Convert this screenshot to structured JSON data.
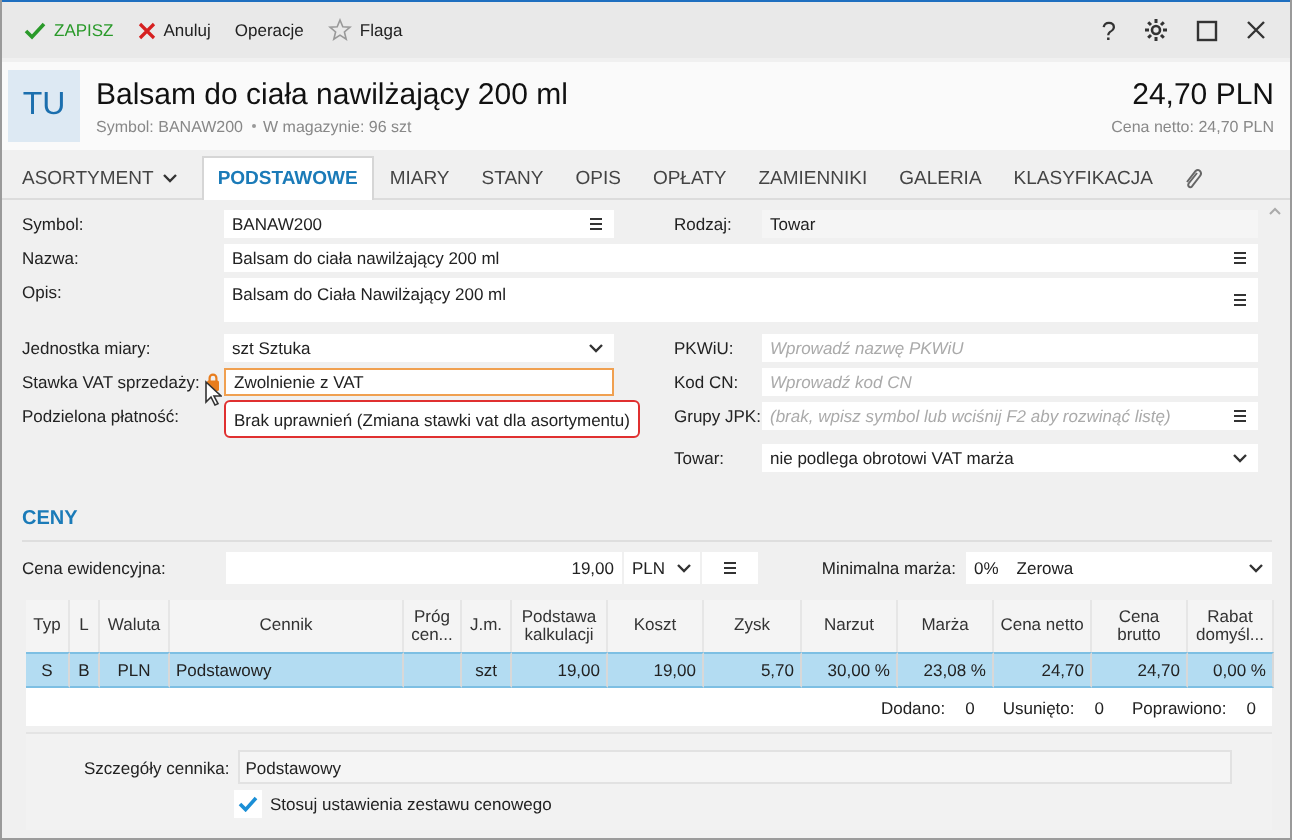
{
  "toolbar": {
    "actions": [
      {
        "kind": "save",
        "label": "ZAPISZ"
      },
      {
        "kind": "cancel",
        "label": "Anuluj"
      },
      {
        "kind": "menu",
        "label": "Operacje"
      },
      {
        "kind": "flag",
        "label": "Flaga"
      }
    ],
    "help": "?"
  },
  "header": {
    "avatar": "TU",
    "title": "Balsam do ciała nawilżający 200 ml",
    "symbol": "Symbol: BANAW200",
    "stock": "W magazynie: 96 szt",
    "price": "24,70 PLN",
    "net_price": "Cena netto: 24,70 PLN"
  },
  "tabs": [
    {
      "label": "ASORTYMENT",
      "kind": "dropdown",
      "selected": false
    },
    {
      "label": "PODSTAWOWE",
      "kind": "tab",
      "selected": true
    },
    {
      "label": "MIARY",
      "kind": "tab",
      "selected": false
    },
    {
      "label": "STANY",
      "kind": "tab",
      "selected": false
    },
    {
      "label": "OPIS",
      "kind": "tab",
      "selected": false
    },
    {
      "label": "OPŁATY",
      "kind": "tab",
      "selected": false
    },
    {
      "label": "ZAMIENNIKI",
      "kind": "tab",
      "selected": false
    },
    {
      "label": "GALERIA",
      "kind": "tab",
      "selected": false
    },
    {
      "label": "KLASYFIKACJA",
      "kind": "tab",
      "selected": false
    },
    {
      "kind": "attachment",
      "selected": false
    }
  ],
  "form": {
    "rows": [
      [
        {
          "label": "Symbol:",
          "value": "BANAW200",
          "kind": "list"
        },
        {
          "label": "Rodzaj:",
          "value": "Towar",
          "kind": "readonly"
        }
      ],
      [
        {
          "label": "Nazwa:",
          "value": "Balsam do ciała nawilżający 200 ml",
          "kind": "list"
        }
      ],
      [
        {
          "label": "Opis:",
          "value": "Balsam do Ciała Nawilżający 200 ml",
          "kind": "memo"
        }
      ]
    ],
    "left": [
      {
        "label": "Jednostka miary:",
        "value": "szt  Sztuka",
        "kind": "select"
      },
      {
        "label": "Stawka VAT sprzedaży:",
        "value": "Zwolnienie z VAT",
        "kind": "locked"
      },
      {
        "label": "Podzielona płatność:",
        "kind": "label"
      }
    ],
    "right": [
      {
        "label": "PKWiU:",
        "placeholder": "Wprowadź nazwę PKWiU",
        "kind": "text"
      },
      {
        "label": "Kod CN:",
        "placeholder": "Wprowadź kod CN",
        "kind": "text"
      },
      {
        "label": "Grupy JPK:",
        "placeholder": "(brak, wpisz symbol lub wciśnij F2 aby rozwinąć listę)",
        "kind": "list"
      },
      {
        "label": "Towar:",
        "value": "nie podlega obrotowi VAT marża",
        "kind": "select"
      }
    ],
    "tooltip": "Brak uprawnień (Zmiana stawki vat dla asortymentu)"
  },
  "prices": {
    "title": "CENY",
    "record_price": {
      "label": "Cena ewidencyjna:",
      "value": "19,00",
      "currency": "PLN"
    },
    "min_margin": {
      "label": "Minimalna marża:",
      "percent": "0%",
      "name": "Zerowa"
    },
    "table": {
      "columns": [
        {
          "label": "Typ",
          "kind": "code"
        },
        {
          "label": "L",
          "kind": "code"
        },
        {
          "label": "Waluta",
          "kind": "code"
        },
        {
          "label": "Cennik",
          "kind": "text"
        },
        {
          "label": "Próg cen...",
          "kind": "number"
        },
        {
          "label": "J.m.",
          "kind": "code"
        },
        {
          "label": "Podstawa kalkulacji",
          "kind": "number"
        },
        {
          "label": "Koszt",
          "kind": "number"
        },
        {
          "label": "Zysk",
          "kind": "number"
        },
        {
          "label": "Narzut",
          "kind": "number"
        },
        {
          "label": "Marża",
          "kind": "number"
        },
        {
          "label": "Cena netto",
          "kind": "number"
        },
        {
          "label": "Cena brutto",
          "kind": "number"
        },
        {
          "label": "Rabat domyśl...",
          "kind": "number"
        }
      ],
      "rows": [
        {
          "selected": true,
          "cells": [
            "S",
            "B",
            "PLN",
            "Podstawowy",
            null,
            "szt",
            "19,00",
            "19,00",
            "5,70",
            "30,00 %",
            "23,08 %",
            "24,70",
            "24,70",
            "0,00 %"
          ]
        }
      ]
    },
    "counters": [
      {
        "label": "Dodano:",
        "value": "0"
      },
      {
        "label": "Usunięto:",
        "value": "0"
      },
      {
        "label": "Poprawiono:",
        "value": "0"
      }
    ],
    "details": {
      "label": "Szczegóły cennika:",
      "value": "Podstawowy"
    },
    "apply_set": {
      "label": "Stosuj ustawienia zestawu cenowego",
      "checked": true
    }
  }
}
